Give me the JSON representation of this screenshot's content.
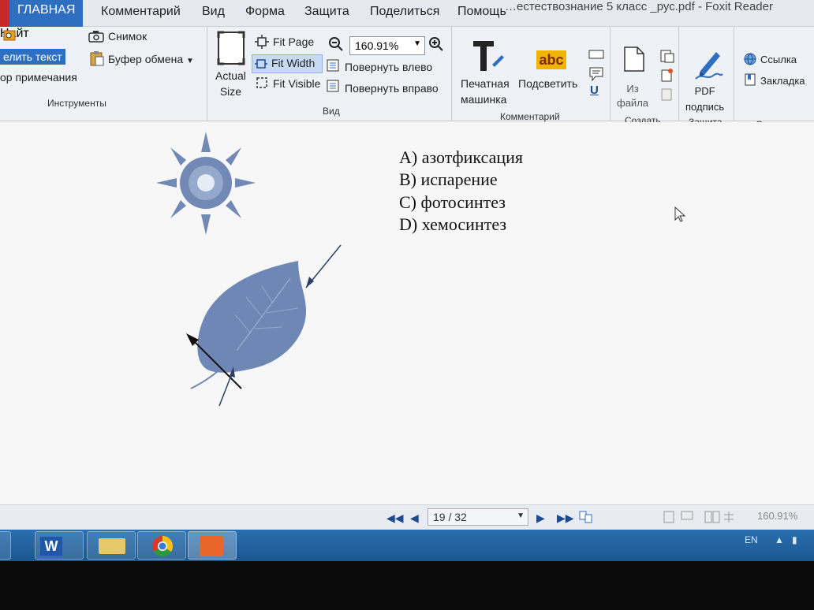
{
  "window": {
    "title": "…естествознание 5 класс _рус.pdf - Foxit Reader"
  },
  "menu": {
    "tabs": [
      "ГЛАВНАЯ",
      "Комментарий",
      "Вид",
      "Форма",
      "Защита",
      "Поделиться",
      "Помощь"
    ],
    "search_placeholder": "Найт"
  },
  "ribbon": {
    "tools": {
      "snapshot": "Снимок",
      "clipboard": "Буфер обмена",
      "select_text": "елить текст",
      "note_select": "ор примечания",
      "group": "Инструменты"
    },
    "view": {
      "actual_size": [
        "Actual",
        "Size"
      ],
      "fit_page": "Fit Page",
      "fit_width": "Fit Width",
      "fit_visible": "Fit Visible",
      "zoom_value": "160.91%",
      "rotate_left": "Повернуть влево",
      "rotate_right": "Повернуть вправо",
      "group": "Вид"
    },
    "comment": {
      "typewriter": [
        "Печатная",
        "машинка"
      ],
      "highlight": "Подсветить",
      "highlight_icon_text": "abc",
      "underline_icon_text": "U",
      "group": "Комментарий"
    },
    "create": {
      "from_file": [
        "Из",
        "файла"
      ],
      "group": "Создать"
    },
    "protect": {
      "pdf_sign": [
        "PDF",
        "подпись"
      ],
      "group": "Защита"
    },
    "links": {
      "link": "Ссылка",
      "bookmark": "Закладка",
      "group": "Ссылки"
    }
  },
  "document": {
    "answers": [
      "A)  азотфиксация",
      "B)  испарение",
      "C)  фотосинтез",
      "D)  хемосинтез"
    ]
  },
  "navigation": {
    "page": "19 / 32",
    "zoom": "160.91%"
  },
  "taskbar": {
    "lang": "EN",
    "word_icon_text": "W"
  },
  "colors": {
    "accent": "#2e6fc2",
    "illustration": "#6f87b4",
    "taskbar": "#2a6fb0"
  }
}
